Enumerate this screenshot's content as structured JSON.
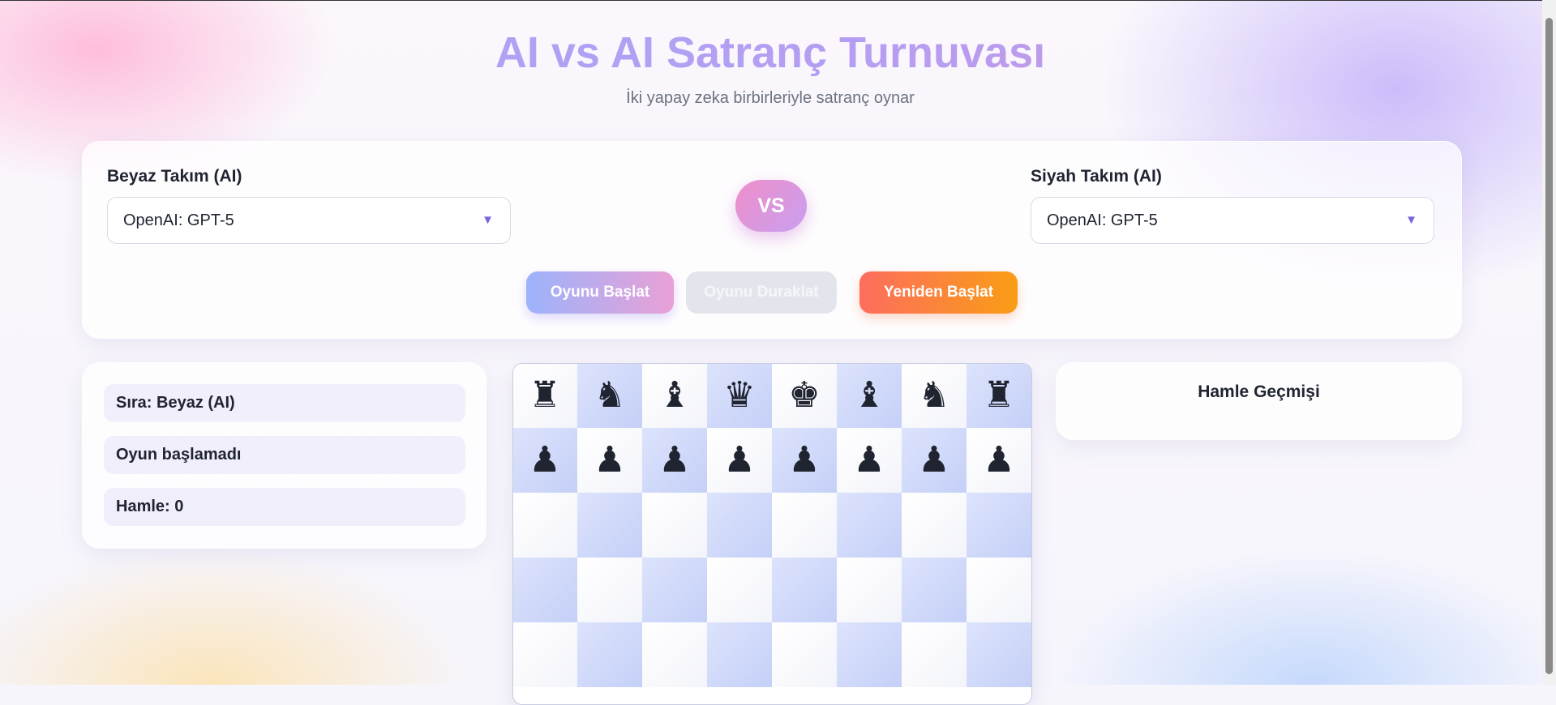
{
  "header": {
    "title": "AI vs AI Satranç Turnuvası",
    "subtitle": "İki yapay zeka birbirleriyle satranç oynar"
  },
  "setup": {
    "white_team_label": "Beyaz Takım (AI)",
    "white_model": "OpenAI: GPT-5",
    "black_team_label": "Siyah Takım (AI)",
    "black_model": "OpenAI: GPT-5",
    "vs_label": "VS",
    "dropdown_icon": "triangle-down-icon",
    "buttons": {
      "start": "Oyunu Başlat",
      "pause": "Oyunu Duraklat",
      "restart": "Yeniden Başlat"
    }
  },
  "status": {
    "turn": "Sıra: Beyaz (AI)",
    "state": "Oyun başlamadı",
    "moves": "Hamle: 0"
  },
  "history": {
    "title": "Hamle Geçmişi"
  },
  "board": {
    "visible_ranks": [
      [
        "♜",
        "♞",
        "♝",
        "♛",
        "♚",
        "♝",
        "♞",
        "♜"
      ],
      [
        "♟",
        "♟",
        "♟",
        "♟",
        "♟",
        "♟",
        "♟",
        "♟"
      ],
      [
        "",
        "",
        "",
        "",
        "",
        "",
        "",
        ""
      ],
      [
        "",
        "",
        "",
        "",
        "",
        "",
        "",
        ""
      ],
      [
        "",
        "",
        "",
        "",
        "",
        "",
        "",
        ""
      ]
    ],
    "colors": {
      "light": "#ffffff",
      "dark": "#cbd5fa"
    }
  },
  "theme": {
    "accent": "#7a62e0",
    "start_gradient": [
      "#9cb3fb",
      "#e9a0d6"
    ],
    "restart_gradient": [
      "#fd6d5e",
      "#f99d15"
    ]
  }
}
